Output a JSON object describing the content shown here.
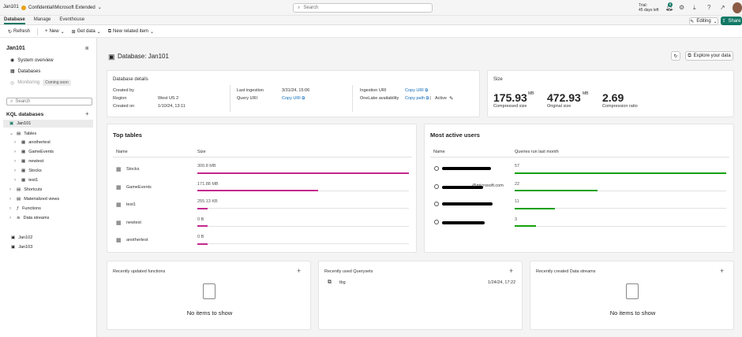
{
  "topbar": {
    "workspace": "Jan101",
    "sensitivity": "Confidential\\Microsoft Extended",
    "search_placeholder": "Search",
    "trial_line1": "Trial:",
    "trial_line2": "45 days left",
    "notif_count": "5",
    "editing": "Editing",
    "share": "Share"
  },
  "tabs": [
    "Database",
    "Manage",
    "Eventhouse"
  ],
  "toolbar": {
    "refresh": "Refresh",
    "new": "New",
    "get_data": "Get data",
    "new_related": "New related item"
  },
  "sidebar": {
    "title": "Jan101",
    "system_overview": "System overview",
    "databases": "Databases",
    "monitoring": "Monitoring",
    "coming_soon": "Coming soon",
    "search_placeholder": "Search",
    "kql_header": "KQL databases",
    "db": "Jan101",
    "tables_label": "Tables",
    "tables": [
      "anothertest",
      "GameEvents",
      "newtest",
      "Stocks",
      "test1"
    ],
    "shortcuts": "Shortcuts",
    "materialized": "Materialized views",
    "functions": "Functions",
    "data_streams": "Data streams",
    "other_dbs": [
      "Jan102",
      "Jan103"
    ]
  },
  "header": {
    "title": "Database: Jan101",
    "explore": "Explore your data"
  },
  "details": {
    "title": "Database details",
    "created_by_label": "Created by",
    "region_label": "Region",
    "region": "West US 2",
    "created_on_label": "Created on",
    "created_on": "1/10/24, 13:11",
    "last_ingestion_label": "Last ingestion",
    "last_ingestion": "3/31/24, 15:06",
    "query_uri_label": "Query URI",
    "copy_uri": "Copy URI",
    "ingestion_uri_label": "Ingestion URI",
    "onelake_label": "OneLake availability",
    "copy_path": "Copy path",
    "active": "Active"
  },
  "size": {
    "title": "Size",
    "compressed": "175.93",
    "compressed_unit": "MB",
    "compressed_label": "Compressed size",
    "original": "472.93",
    "original_unit": "MB",
    "original_label": "Original size",
    "ratio": "2.69",
    "ratio_label": "Compression ratio"
  },
  "top_tables": {
    "title": "Top tables",
    "col_name": "Name",
    "col_size": "Size",
    "rows": [
      {
        "name": "Stocks",
        "size": "300.8 MB",
        "fraction": 1.0
      },
      {
        "name": "GameEvents",
        "size": "171.88 MB",
        "fraction": 0.57
      },
      {
        "name": "test1",
        "size": "255.13 KB",
        "fraction": 0.05
      },
      {
        "name": "newtest",
        "size": "0 B",
        "fraction": 0.05
      },
      {
        "name": "anothertest",
        "size": "0 B",
        "fraction": 0.05
      }
    ]
  },
  "active_users": {
    "title": "Most active users",
    "col_name": "Name",
    "col_queries": "Queries run last month",
    "rows": [
      {
        "name_suffix": "",
        "queries": "57",
        "fraction": 1.0
      },
      {
        "name_suffix": "@microsoft.com",
        "queries": "22",
        "fraction": 0.39
      },
      {
        "name_suffix": "",
        "queries": "11",
        "fraction": 0.19
      },
      {
        "name_suffix": "",
        "queries": "3",
        "fraction": 0.1
      }
    ]
  },
  "recent_functions": {
    "title": "Recently updated functions",
    "empty": "No items to show"
  },
  "recent_querysets": {
    "title": "Recently used Querysets",
    "item": "tbg",
    "date": "1/24/24, 17:22"
  },
  "recent_streams": {
    "title": "Recently created Data streams",
    "empty": "No items to show"
  },
  "colors": {
    "accent": "#117865",
    "table_bar": "#c4288e",
    "user_bar": "#13a10e"
  }
}
